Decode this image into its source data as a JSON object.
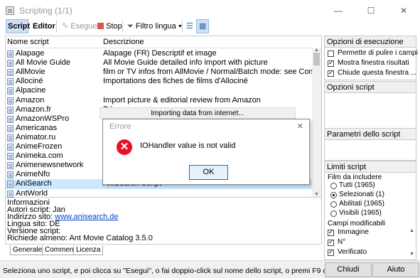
{
  "window": {
    "title": "Scripting (1/1)",
    "minimize": "—",
    "maximize": "☐",
    "close": "✕"
  },
  "toolbar": {
    "tab_script": "Script",
    "tab_editor": "Editor",
    "run": "Esegue",
    "stop": "Stop",
    "filter": "Filtro lingua ▾"
  },
  "list": {
    "col_name": "Nome script",
    "col_desc": "Descrizione",
    "rows": [
      {
        "name": "Alapage",
        "desc": "Alapage (FR) Descriptif et image"
      },
      {
        "name": "All Movie Guide",
        "desc": "All Movie Guide detailed info import with picture"
      },
      {
        "name": "AllMovie",
        "desc": "film or TV infos from  AllMovie / Normal/Batch mode: see Comments tab"
      },
      {
        "name": "Allociné",
        "desc": "Importations des fiches de films d'Allociné"
      },
      {
        "name": "Alpacine",
        "desc": ""
      },
      {
        "name": "Amazon",
        "desc": "Import picture & editorial review from Amazon"
      },
      {
        "name": "Amazon.fr",
        "desc": "Récup"
      },
      {
        "name": "AmazonWSPro",
        "desc": "Fi"
      },
      {
        "name": "Americanas",
        "desc": "Mo"
      },
      {
        "name": "Animator.ru",
        "desc": "Im"
      },
      {
        "name": "AnimeFrozen",
        "desc": "Sc"
      },
      {
        "name": "Animeka.com",
        "desc": "Re"
      },
      {
        "name": "Animenewsnetwork",
        "desc": "Sc"
      },
      {
        "name": "AnimeNfo",
        "desc": "An"
      },
      {
        "name": "AniSearch",
        "desc": "AniSearch Script"
      },
      {
        "name": "AntWorld",
        "desc": ""
      }
    ]
  },
  "info": {
    "heading": "Informazioni",
    "authors": "Autori script: Jan",
    "site_label": "Indirizzo sito: ",
    "site_url": "www.anisearch.de",
    "language": "Lingua sito: DE",
    "version": "Versione script:",
    "requires": "Richiede almeno: Ant Movie Catalog 3.5.0"
  },
  "bottom_tabs": [
    "Generale",
    "Commenti",
    "Licenza"
  ],
  "side": {
    "exec_header": "Opzioni di esecuzione",
    "exec_options": [
      {
        "label": "Permette di pulire i campi",
        "checked": false
      },
      {
        "label": "Mostra finestra risultati",
        "checked": true
      },
      {
        "label": "Chiude questa finestra ...",
        "checked": true
      }
    ],
    "script_opts_header": "Opzioni script",
    "params_header": "Parametri dello script",
    "limits_header": "Limiti script",
    "films_label": "Film da includere",
    "film_options": [
      {
        "label": "Tutti (1965)",
        "selected": false
      },
      {
        "label": "Selezionati (1)",
        "selected": true
      },
      {
        "label": "Abilitati (1965)",
        "selected": false
      },
      {
        "label": "Visibili (1965)",
        "selected": false
      }
    ],
    "fields_label": "Campi modificabili",
    "fields": [
      {
        "label": "Immagine",
        "checked": true
      },
      {
        "label": "N°",
        "checked": true
      },
      {
        "label": "Verificato",
        "checked": true
      }
    ]
  },
  "status": {
    "text": "Seleziona uno script, e poi clicca su \"Esegui\", o fai doppio-click sul nome dello script, o premi F9 oppure Invio.",
    "close_button": "Chiudi",
    "help_button": "Aiuto"
  },
  "progress": {
    "text": "Importing data from internet..."
  },
  "dialog": {
    "title": "Errore",
    "close": "✕",
    "message": "IOHandler value is not valid",
    "ok": "OK"
  }
}
